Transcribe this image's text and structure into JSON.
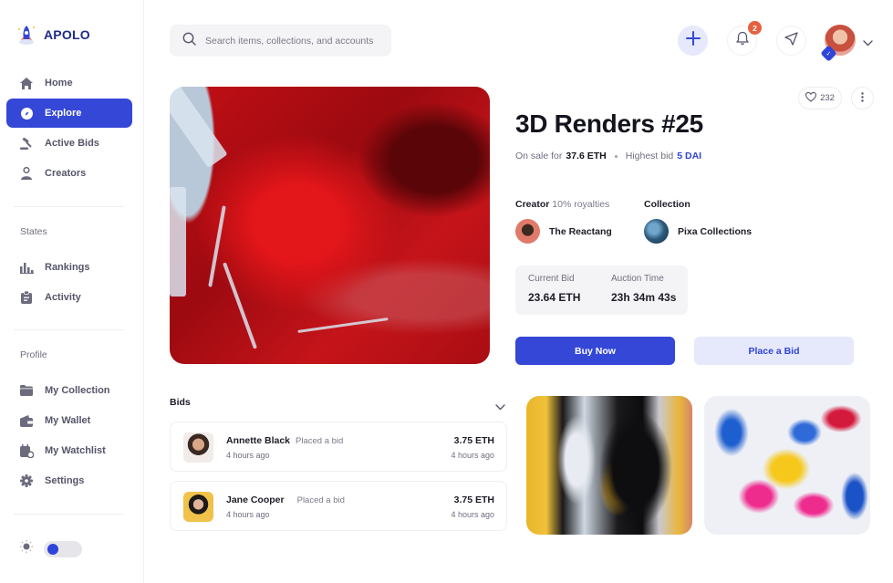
{
  "app": {
    "name": "APOLO"
  },
  "sidebar": {
    "main_items": [
      {
        "label": "Home",
        "icon": "home-icon",
        "active": false
      },
      {
        "label": "Explore",
        "icon": "compass-icon",
        "active": true
      },
      {
        "label": "Active Bids",
        "icon": "gavel-icon",
        "active": false
      },
      {
        "label": "Creators",
        "icon": "user-icon",
        "active": false
      }
    ],
    "states_label": "States",
    "states_items": [
      {
        "label": "Rankings",
        "icon": "bar-chart-icon"
      },
      {
        "label": "Activity",
        "icon": "clipboard-icon"
      }
    ],
    "profile_label": "Profile",
    "profile_items": [
      {
        "label": "My Collection",
        "icon": "folder-icon"
      },
      {
        "label": "My Wallet",
        "icon": "wallet-icon"
      },
      {
        "label": "My Watchlist",
        "icon": "calendar-watch-icon"
      },
      {
        "label": "Settings",
        "icon": "gear-icon"
      }
    ],
    "theme_toggle": {
      "icon": "sun-icon",
      "dark_mode": false
    }
  },
  "topbar": {
    "search_placeholder": "Search items, collections, and accounts",
    "notifications_count": "2",
    "accent_color": "#3547d6"
  },
  "item": {
    "title": "3D Renders #25",
    "likes": "232",
    "on_sale_prefix": "On sale for",
    "on_sale_price": "37.6 ETH",
    "highest_bid_prefix": "Highest bid",
    "highest_bid_value": "5 DAI",
    "creator_label": "Creator",
    "creator_royalties": "10% royalties",
    "creator_name": "The Reactang",
    "collection_label": "Collection",
    "collection_name": "Pixa Collections",
    "current_bid_label": "Current Bid",
    "current_bid_value": "23.64 ETH",
    "auction_time_label": "Auction Time",
    "auction_time_value": "23h 34m 43s",
    "buy_now_label": "Buy Now",
    "place_bid_label": "Place a Bid"
  },
  "bids": {
    "header": "Bids",
    "rows": [
      {
        "name": "Annette Black",
        "action": "Placed a bid",
        "time": "4 hours ago",
        "amount": "3.75 ETH",
        "time_right": "4 hours ago"
      },
      {
        "name": "Jane Cooper",
        "action": "Placed a bid",
        "time": "4 hours ago",
        "amount": "3.75 ETH",
        "time_right": "4 hours ago"
      }
    ]
  }
}
